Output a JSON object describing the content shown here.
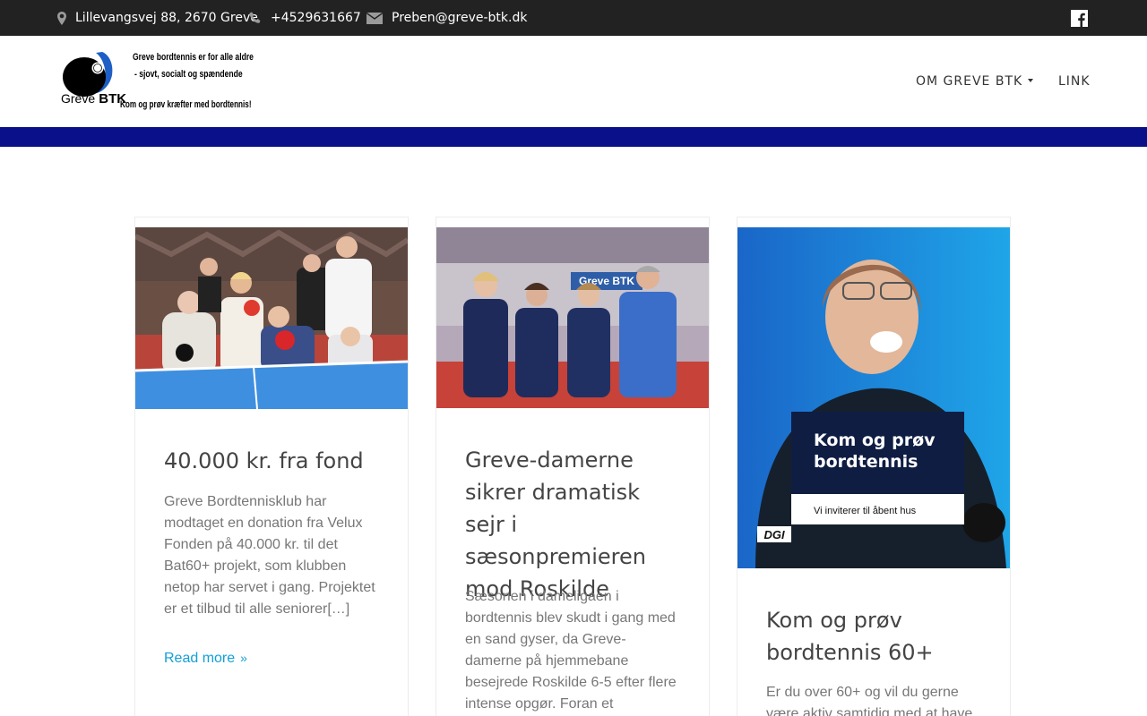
{
  "topbar": {
    "address": "Lillevangsvej 88, 2670 Greve",
    "phone": "+4529631667",
    "email": "Preben@greve-btk.dk",
    "address_icon": "map-marker-icon",
    "phone_icon": "phone-icon",
    "email_icon": "envelope-icon",
    "social_icon": "facebook-icon"
  },
  "logo": {
    "line1": "Greve bordtennis er for alle aldre",
    "line2": "- sjovt, socialt og spændende",
    "brand_prefix": "Greve",
    "brand": "BTK",
    "line4": "Kom og prøv kræfter med bordtennis!"
  },
  "nav": {
    "om_label": "Om Greve BTK",
    "link_label": "Link"
  },
  "colors": {
    "topbar": "#222222",
    "band": "#0a0f8a",
    "accent": "#12a0d8"
  },
  "posts": [
    {
      "title": "40.000 kr. fra fond",
      "excerpt": "Greve Bordtennisklub har modtaget en donation fra Velux Fonden på 40.000 kr. til det Bat60+ projekt, som klubben netop har servet i gang. Projektet er et tilbud til alle seniorer[…]",
      "more": "Read more"
    },
    {
      "title": "Greve-damerne sikrer dramatisk sejr i sæsonpremieren mod Roskilde",
      "excerpt": "Sæsonen i dameligaen i bordtennis blev skudt i gang med en sand gyser, da Greve-damerne på hjemmebane besejrede Roskilde 6-5 efter flere intense opgør. Foran et engageret"
    },
    {
      "title": "Kom og prøv bordtennis 60+",
      "excerpt": "Er du over 60+ og vil du gerne være aktiv samtidig med at have",
      "poster_headline": "Kom og prøv bordtennis",
      "poster_sub": "Vi inviterer til åbent hus",
      "poster_logo": "DGI"
    }
  ],
  "photo2_banner": "Greve BTK"
}
